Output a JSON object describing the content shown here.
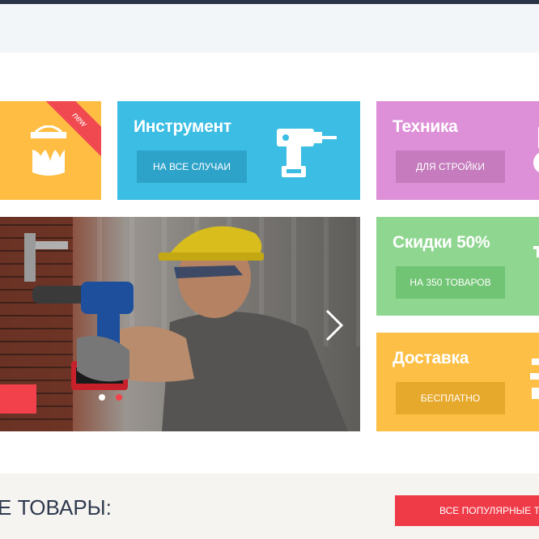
{
  "tiles": {
    "paint": {
      "ribbon": "new",
      "icon": "paint-bucket-icon",
      "color": "#ffbe43"
    },
    "tool": {
      "title": "Инструмент",
      "cta": "НА ВСЕ СЛУЧАИ",
      "icon": "drill-icon",
      "color": "#3cbde3"
    },
    "tech": {
      "title": "Техника",
      "cta": "ДЛЯ СТРОЙКИ",
      "icon": "machine-icon",
      "color": "#dd90d7"
    },
    "sale": {
      "title": "Скидки 50%",
      "cta": "НА 350 ТОВАРОВ",
      "icon": "percent-icon",
      "color": "#8fd690"
    },
    "delivery": {
      "title": "Доставка",
      "cta": "БЕСПЛАТНО",
      "icon": "truck-icon",
      "color": "#fdbf45"
    }
  },
  "slider": {
    "image": "worker-with-drill",
    "active_slide": 2,
    "slide_count": 2
  },
  "popular": {
    "title": "Е ТОВАРЫ:",
    "button": "ВСЕ ПОПУЛЯРНЫЕ ТОВАРЫ"
  }
}
